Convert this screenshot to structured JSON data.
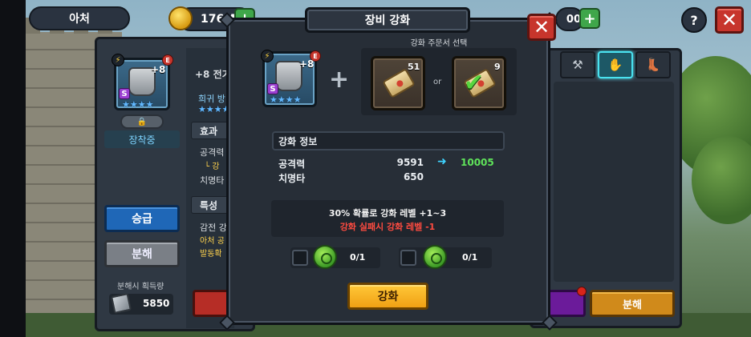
{
  "topbar": {
    "back_label": "아처",
    "gold_amount": "176M",
    "gem_amount": "00",
    "help_label": "?",
    "close_label": "✕",
    "plus_label": "+"
  },
  "left_panel": {
    "item_level": "+8",
    "item_name": "+8 전기",
    "rarity_text": "희귀 방",
    "lock_label": "🔒",
    "equipped_label": "장착중",
    "effect_header": "효과",
    "attack_label": "공격력",
    "attack_sub": "└ 강",
    "crit_label": "치명타",
    "trait_header": "특성",
    "trait_line1": "감전 강",
    "trait_line2": "아처 공",
    "trait_line3": "발동확",
    "upgrade_button": "승급",
    "disassemble_button": "분해",
    "gain_label": "분해시 획득량",
    "gain_value": "5850"
  },
  "right_panel": {
    "tabs": [
      "weapon",
      "gloves",
      "boots"
    ],
    "disassemble_button": "분해"
  },
  "modal": {
    "title": "장비 강화",
    "close_label": "✕",
    "item_level": "+8",
    "rarity_badge": "S",
    "element_badge": "E",
    "bolt_badge": "⚡",
    "item_stars": "★★★★",
    "plus_symbol": "+",
    "scroll_caption": "강화 주문서 선택",
    "scroll_a_count": "51",
    "scroll_b_count": "9",
    "or_label": "or",
    "info_header": "강화 정보",
    "stats": [
      {
        "label": "공격력",
        "current": "9591",
        "next": "10005"
      },
      {
        "label": "치명타",
        "current": "650"
      }
    ],
    "arrow": "➜",
    "chance_text": "30% 확률로 강화 레벨 +1~3",
    "fail_text": "강화 실패시 강화 레벨 -1",
    "stone_a_count": "0/1",
    "stone_b_count": "0/1",
    "enhance_button": "강화"
  },
  "colors": {
    "accent_gold": "#f0a014",
    "close_red": "#c7352c",
    "success_green": "#5fe35a",
    "fail_red": "#ff4b40",
    "arrow_cyan": "#3fd3ff",
    "upgrade_blue": "#1f67b7"
  },
  "icons": [
    "gold-coin-icon",
    "gem-icon",
    "help-icon",
    "close-icon",
    "gauntlet-icon",
    "scroll-icon",
    "checkmark-scroll-icon",
    "green-stone-icon",
    "lock-icon",
    "lightning-icon",
    "silver-ingot-icon"
  ]
}
